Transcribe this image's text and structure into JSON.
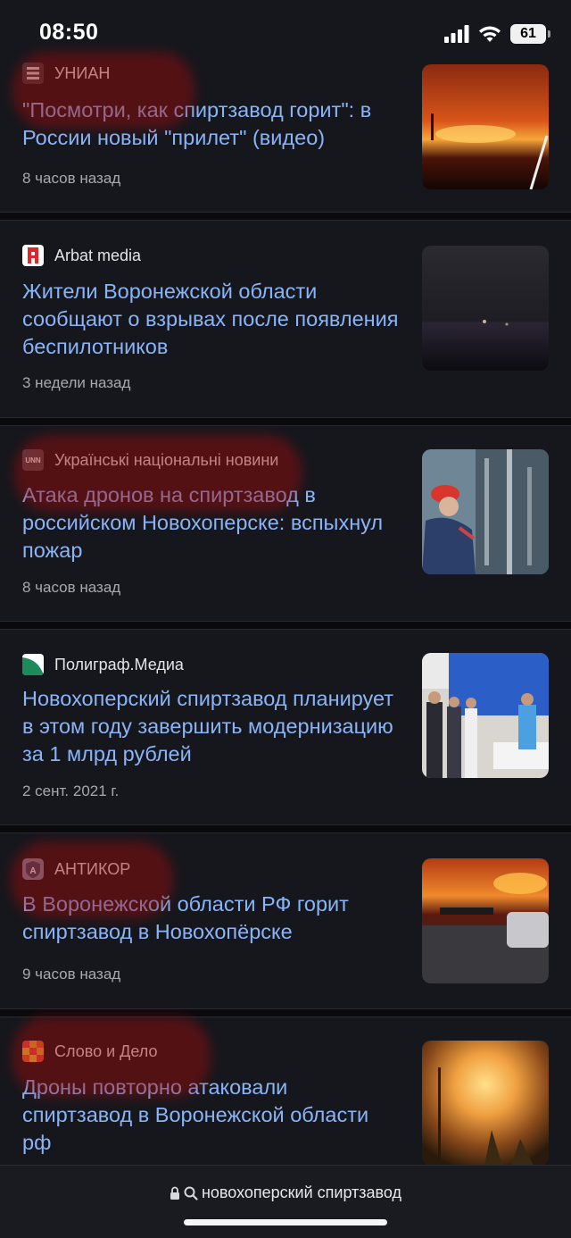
{
  "status_bar": {
    "time": "08:50",
    "battery_percent": "61",
    "signal_icon": "signal-bars-icon",
    "wifi_icon": "wifi-icon"
  },
  "articles": [
    {
      "source": "УНИАН",
      "headline": "\"Посмотри, как спиртзавод горит\": в России новый \"прилет\" (видео)",
      "time": "8 часов назад",
      "thumb": "fire-at-night-image"
    },
    {
      "source": "Arbat media",
      "headline": "Жители Воронежской области сообщают о взрывах после появления беспилотников",
      "time": "3 недели назад",
      "thumb": "night-sky-image"
    },
    {
      "source": "Українські національні новини",
      "headline": "Атака дронов на спиртзавод в российском Новохоперске: вспыхнул пожар",
      "time": "8 часов назад",
      "thumb": "factory-worker-image"
    },
    {
      "source": "Полиграф.Медиа",
      "headline": "Новохоперский спиртзавод планирует в этом году завершить модернизацию за 1 млрд рублей",
      "time": "2 сент. 2021 г.",
      "thumb": "people-at-plant-image"
    },
    {
      "source": "АНТИКОР",
      "headline": "В Воронежской области РФ горит спиртзавод в Новохопёрске",
      "time": "9 часов назад",
      "thumb": "fire-road-image"
    },
    {
      "source": "Слово и Дело",
      "headline": "Дроны повторно атаковали спиртзавод в Воронежской области рф",
      "time": "",
      "thumb": "explosion-fire-image"
    }
  ],
  "address_bar": {
    "lock_icon": "lock-icon",
    "search_icon": "search-icon",
    "query": "новохоперский спиртзавод"
  },
  "colors": {
    "background": "#0e0f13",
    "card": "#16171d",
    "headline_link": "#8ab4f8",
    "redmark": "#a00a0a"
  }
}
